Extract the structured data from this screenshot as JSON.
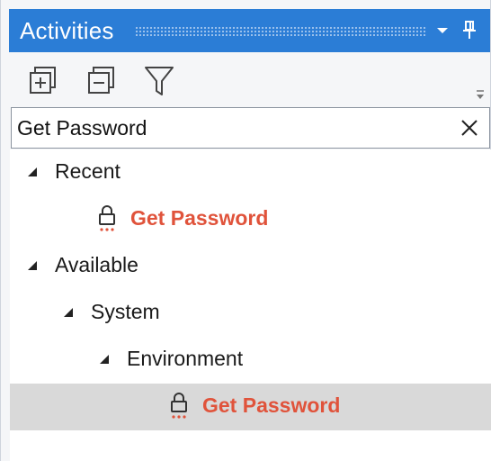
{
  "panel": {
    "title": "Activities"
  },
  "toolbar": {
    "expand_all_icon": "expand-all-icon",
    "collapse_all_icon": "collapse-all-icon",
    "filter_icon": "filter-icon"
  },
  "search": {
    "value": "Get Password",
    "clear_icon": "close-icon"
  },
  "tree": {
    "recent": {
      "label": "Recent",
      "children": [
        {
          "label": "Get Password",
          "icon": "lock-icon"
        }
      ]
    },
    "available": {
      "label": "Available",
      "system": {
        "label": "System",
        "environment": {
          "label": "Environment",
          "children": [
            {
              "label": "Get Password",
              "icon": "lock-icon",
              "selected": true
            }
          ]
        }
      }
    }
  },
  "colors": {
    "title_bar": "#2b7dd6",
    "activity_text": "#e0533b",
    "selected_row": "#d9d9d9"
  }
}
